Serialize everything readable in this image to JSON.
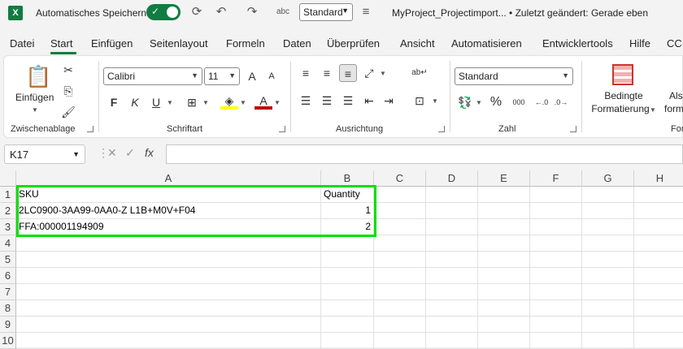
{
  "titlebar": {
    "app_logo": "X",
    "autosave_label": "Automatisches Speichern",
    "style_value": "Standard",
    "doc_title": "MyProject_Projectimport... • Zuletzt geändert: Gerade eben",
    "icons": [
      "excel-icon",
      "save-icon",
      "undo-icon",
      "redo-icon",
      "spelling-icon",
      "customize-icon"
    ]
  },
  "menu": {
    "items": [
      "Datei",
      "Start",
      "Einfügen",
      "Seitenlayout",
      "Formeln",
      "Daten",
      "Überprüfen",
      "Ansicht",
      "Automatisieren",
      "Entwicklertools",
      "Hilfe",
      "CCI"
    ],
    "active": "Start"
  },
  "ribbon": {
    "clipboard": {
      "paste_label": "Einfügen",
      "group_label": "Zwischenablage"
    },
    "font": {
      "font_name": "Calibri",
      "font_size": "11",
      "bold": "F",
      "italic": "K",
      "underline": "U",
      "grow": "A",
      "shrink": "A",
      "group_label": "Schriftart",
      "font_color": "#c00000",
      "highlight_color": "#ffff00"
    },
    "alignment": {
      "group_label": "Ausrichtung"
    },
    "number": {
      "format": "Standard",
      "percent": "%",
      "thousands": "000",
      "group_label": "Zahl"
    },
    "styles": {
      "cond_format_line1": "Bedingte",
      "cond_format_line2": "Formatierung",
      "table_line1": "Als",
      "table_line2": "forma",
      "group_label": "For"
    }
  },
  "formula_bar": {
    "name_box": "K17",
    "fx": "fx",
    "formula": ""
  },
  "sheet": {
    "columns": [
      "A",
      "B",
      "C",
      "D",
      "E",
      "F",
      "G",
      "H"
    ],
    "rows": [
      "1",
      "2",
      "3",
      "4",
      "5",
      "6",
      "7",
      "8",
      "9",
      "10"
    ],
    "cells": {
      "A1": "SKU",
      "B1": "Quantity",
      "A2": "2LC0900-3AA99-0AA0-Z L1B+M0V+F04",
      "B2": "1",
      "A3": "FFA:000001194909",
      "B3": "2"
    },
    "highlight_color": "#00e000"
  }
}
